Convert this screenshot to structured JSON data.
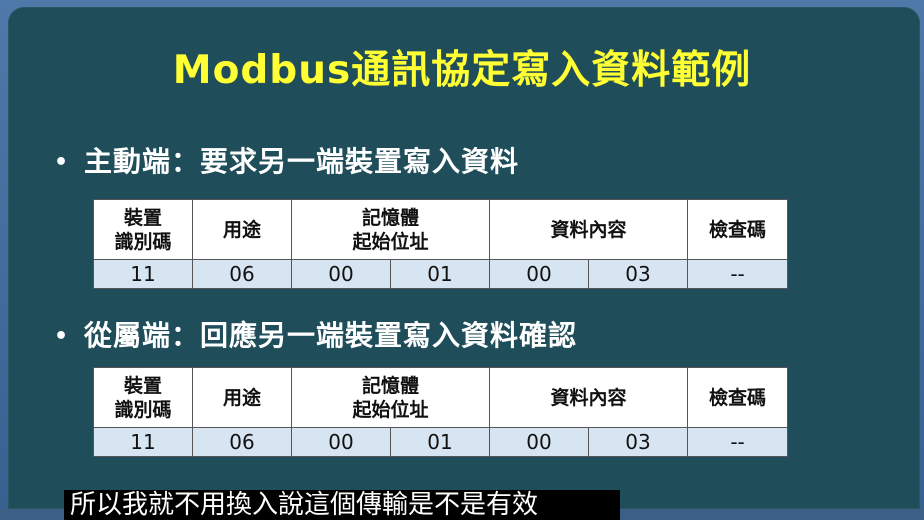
{
  "title": "Modbus通訊協定寫入資料範例",
  "sections": [
    {
      "bullet": "•",
      "heading": "主動端：要求另一端裝置寫入資料",
      "headers": [
        "裝置\n識別碼",
        "用途",
        "記憶體\n起始位址",
        "資料內容",
        "檢查碼"
      ],
      "values": [
        "11",
        "06",
        "00",
        "01",
        "00",
        "03",
        "--"
      ]
    },
    {
      "bullet": "•",
      "heading": "從屬端：回應另一端裝置寫入資料確認",
      "headers": [
        "裝置\n識別碼",
        "用途",
        "記憶體\n起始位址",
        "資料內容",
        "檢查碼"
      ],
      "values": [
        "11",
        "06",
        "00",
        "01",
        "00",
        "03",
        "--"
      ]
    }
  ],
  "caption": "所以我就不用換入說這個傳輸是不是有效"
}
